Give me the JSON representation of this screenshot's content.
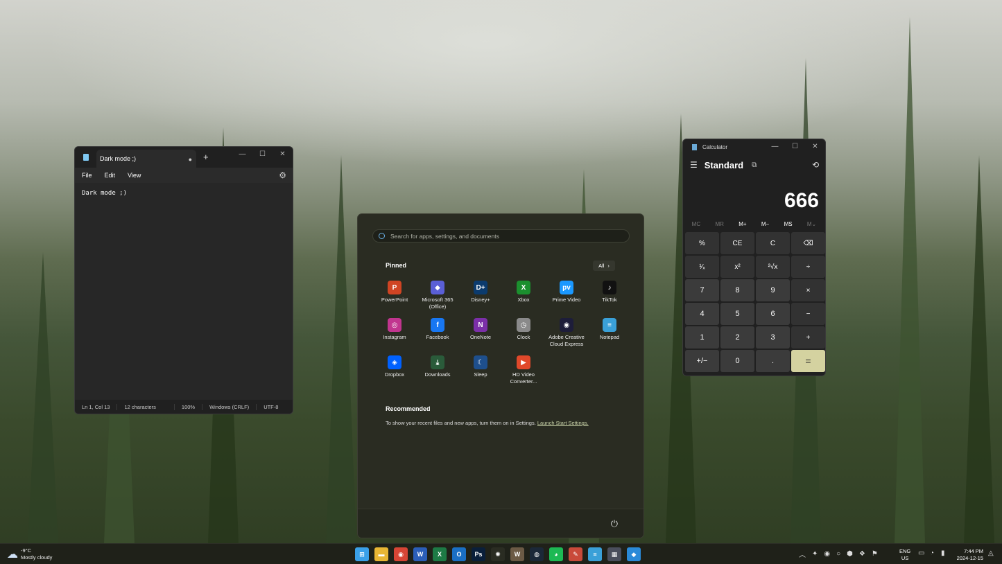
{
  "notepad": {
    "tab_title": "Dark mode ;)",
    "tab_modified": "●",
    "new_tab": "+",
    "controls": {
      "min": "—",
      "max": "☐",
      "close": "✕"
    },
    "menu": [
      "File",
      "Edit",
      "View"
    ],
    "settings_icon": "⚙",
    "content": "Dark mode ;)",
    "status": {
      "position": "Ln 1, Col 13",
      "chars": "12 characters",
      "zoom": "100%",
      "line_ending": "Windows (CRLF)",
      "encoding": "UTF-8"
    }
  },
  "calculator": {
    "title": "Calculator",
    "controls": {
      "min": "—",
      "max": "☐",
      "close": "✕"
    },
    "menu_icon": "☰",
    "mode": "Standard",
    "keep_on_top_icon": "⧉",
    "history_icon": "⟲",
    "display": "666",
    "memory": [
      "MC",
      "MR",
      "M+",
      "M−",
      "MS",
      "M⌄"
    ],
    "keys": [
      "%",
      "CE",
      "C",
      "⌫",
      "¹⁄ₓ",
      "x²",
      "²√x",
      "÷",
      "7",
      "8",
      "9",
      "×",
      "4",
      "5",
      "6",
      "−",
      "1",
      "2",
      "3",
      "+",
      "+/−",
      "0",
      ".",
      "="
    ]
  },
  "start_menu": {
    "search_placeholder": "Search for apps, settings, and documents",
    "pinned_label": "Pinned",
    "all_label": "All",
    "all_chevron": "›",
    "pinned": [
      {
        "label": "PowerPoint",
        "glyph": "P",
        "color": "#d04423"
      },
      {
        "label": "Microsoft 365 (Office)",
        "glyph": "◆",
        "color": "#5a5fd6"
      },
      {
        "label": "Disney+",
        "glyph": "D+",
        "color": "#0b3b6e"
      },
      {
        "label": "Xbox",
        "glyph": "X",
        "color": "#1b8f2e"
      },
      {
        "label": "Prime Video",
        "glyph": "pv",
        "color": "#1a98ff"
      },
      {
        "label": "TikTok",
        "glyph": "♪",
        "color": "#111111"
      },
      {
        "label": "Instagram",
        "glyph": "◎",
        "color": "#c1358f"
      },
      {
        "label": "Facebook",
        "glyph": "f",
        "color": "#1877f2"
      },
      {
        "label": "OneNote",
        "glyph": "N",
        "color": "#7b2fa8"
      },
      {
        "label": "Clock",
        "glyph": "◷",
        "color": "#8a8a8a"
      },
      {
        "label": "Adobe Creative Cloud Express",
        "glyph": "◉",
        "color": "#1d1d3a"
      },
      {
        "label": "Notepad",
        "glyph": "≡",
        "color": "#3aa0d8"
      },
      {
        "label": "Dropbox",
        "glyph": "◈",
        "color": "#0061ff"
      },
      {
        "label": "Downloads",
        "glyph": "⤓",
        "color": "#2a5b3a"
      },
      {
        "label": "Sleep",
        "glyph": "☾",
        "color": "#1e4f8c"
      },
      {
        "label": "HD Video Converter...",
        "glyph": "▶",
        "color": "#e0482a"
      }
    ],
    "recommended_label": "Recommended",
    "recommended_text": "To show your recent files and new apps, turn them on in Settings.",
    "recommended_link": "Launch Start Settings.",
    "power_icon": "⏻"
  },
  "taskbar": {
    "weather_temp": "-9°C",
    "weather_desc": "Mostly cloudy",
    "weather_icon": "☁",
    "apps": [
      {
        "name": "start",
        "glyph": "⊞",
        "color": "#3aa0e8"
      },
      {
        "name": "file-explorer",
        "glyph": "▬",
        "color": "#e8b634"
      },
      {
        "name": "chrome",
        "glyph": "◉",
        "color": "#d64535"
      },
      {
        "name": "word",
        "glyph": "W",
        "color": "#2b5eb8"
      },
      {
        "name": "excel",
        "glyph": "X",
        "color": "#1d7a45"
      },
      {
        "name": "outlook",
        "glyph": "O",
        "color": "#1a6fc4"
      },
      {
        "name": "photoshop",
        "glyph": "Ps",
        "color": "#0a1f3a"
      },
      {
        "name": "chatgpt",
        "glyph": "✺",
        "color": "#2a2c22"
      },
      {
        "name": "wordpad",
        "glyph": "W",
        "color": "#6b5a45"
      },
      {
        "name": "steam",
        "glyph": "◍",
        "color": "#1b2838"
      },
      {
        "name": "spotify",
        "glyph": "◕",
        "color": "#1db954"
      },
      {
        "name": "paint",
        "glyph": "✎",
        "color": "#c94a3a"
      },
      {
        "name": "notepad",
        "glyph": "≡",
        "color": "#3aa0d8"
      },
      {
        "name": "calculator",
        "glyph": "▦",
        "color": "#4a4e5c"
      },
      {
        "name": "box-app",
        "glyph": "◆",
        "color": "#2a8ad8"
      }
    ],
    "tray_chevron": "︿",
    "tray_icons": [
      "✦",
      "◉",
      "○",
      "⬢",
      "❖",
      "⚑"
    ],
    "lang_1": "ENG",
    "lang_2": "US",
    "time": "7:44 PM",
    "date": "2024-12-15",
    "bell_icon": "🔔"
  }
}
